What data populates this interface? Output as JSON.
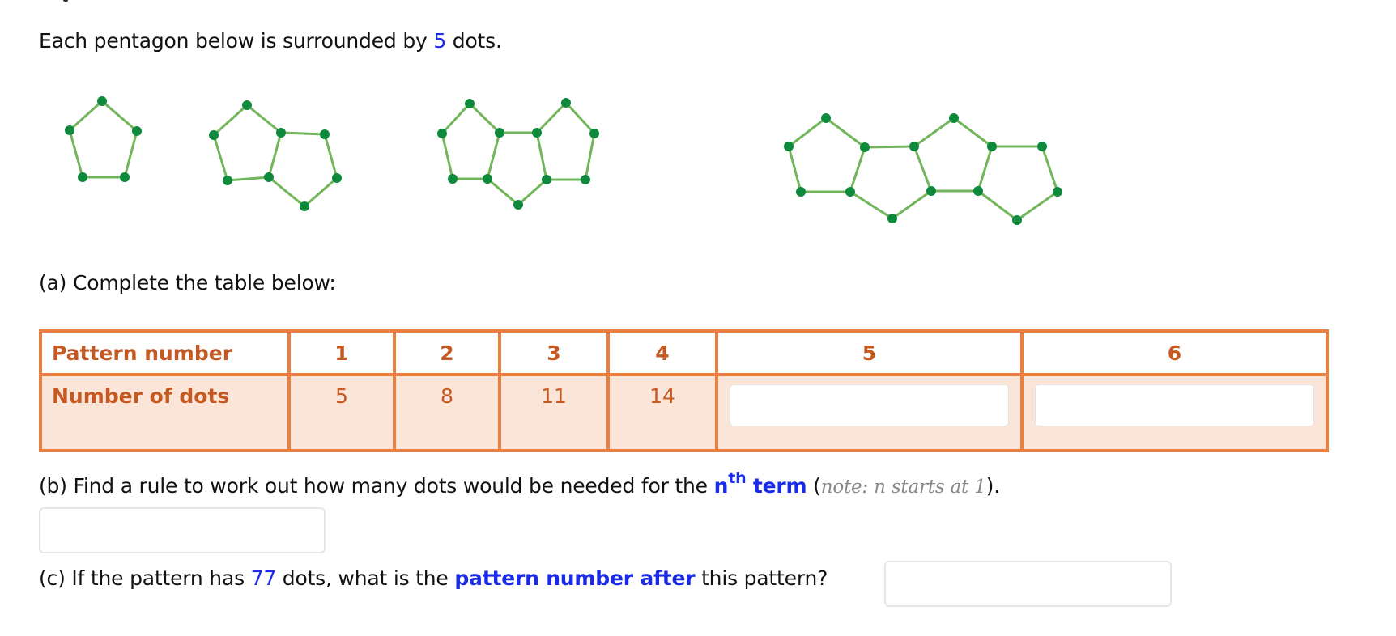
{
  "intro": {
    "prefix": "Each pentagon below is surrounded by ",
    "highlight": "5",
    "suffix": " dots."
  },
  "diagram": {
    "line_color": "#72b55a",
    "dot_color": "#0f8a3c",
    "patterns": [
      {
        "pattern_number": 1,
        "dot_count": 5,
        "pentagons": 1
      },
      {
        "pattern_number": 2,
        "dot_count": 8,
        "pentagons": 2
      },
      {
        "pattern_number": 3,
        "dot_count": 11,
        "pentagons": 3
      },
      {
        "pattern_number": 4,
        "dot_count": 14,
        "pentagons": 4
      }
    ]
  },
  "part_a": {
    "label": "(a) Complete the table below:"
  },
  "table": {
    "row_headers": [
      "Pattern number",
      "Number of dots"
    ],
    "pattern_numbers": [
      "1",
      "2",
      "3",
      "4",
      "5",
      "6"
    ],
    "dot_values": [
      "5",
      "8",
      "11",
      "14"
    ],
    "empty_inputs": [
      {
        "pattern": "5",
        "value": ""
      },
      {
        "pattern": "6",
        "value": ""
      }
    ],
    "colors": {
      "border": "#e9803f",
      "text": "#c45a22",
      "row_fill": "#fbe4d8"
    }
  },
  "part_b": {
    "prefix": "(b) Find a rule to work out how many dots would be needed for the ",
    "n": "n",
    "th": "th",
    "term": " term",
    "open_paren": " (",
    "note": "note: n starts at 1",
    "close": ").",
    "input_value": ""
  },
  "part_c": {
    "prefix": "(c) If the pattern has ",
    "dots_value": "77",
    "middle": " dots, what is the ",
    "highlight": "pattern number after",
    "suffix": " this pattern?",
    "input_value": ""
  },
  "colors": {
    "accent_blue": "#1a2be8",
    "note_gray": "#888888"
  }
}
